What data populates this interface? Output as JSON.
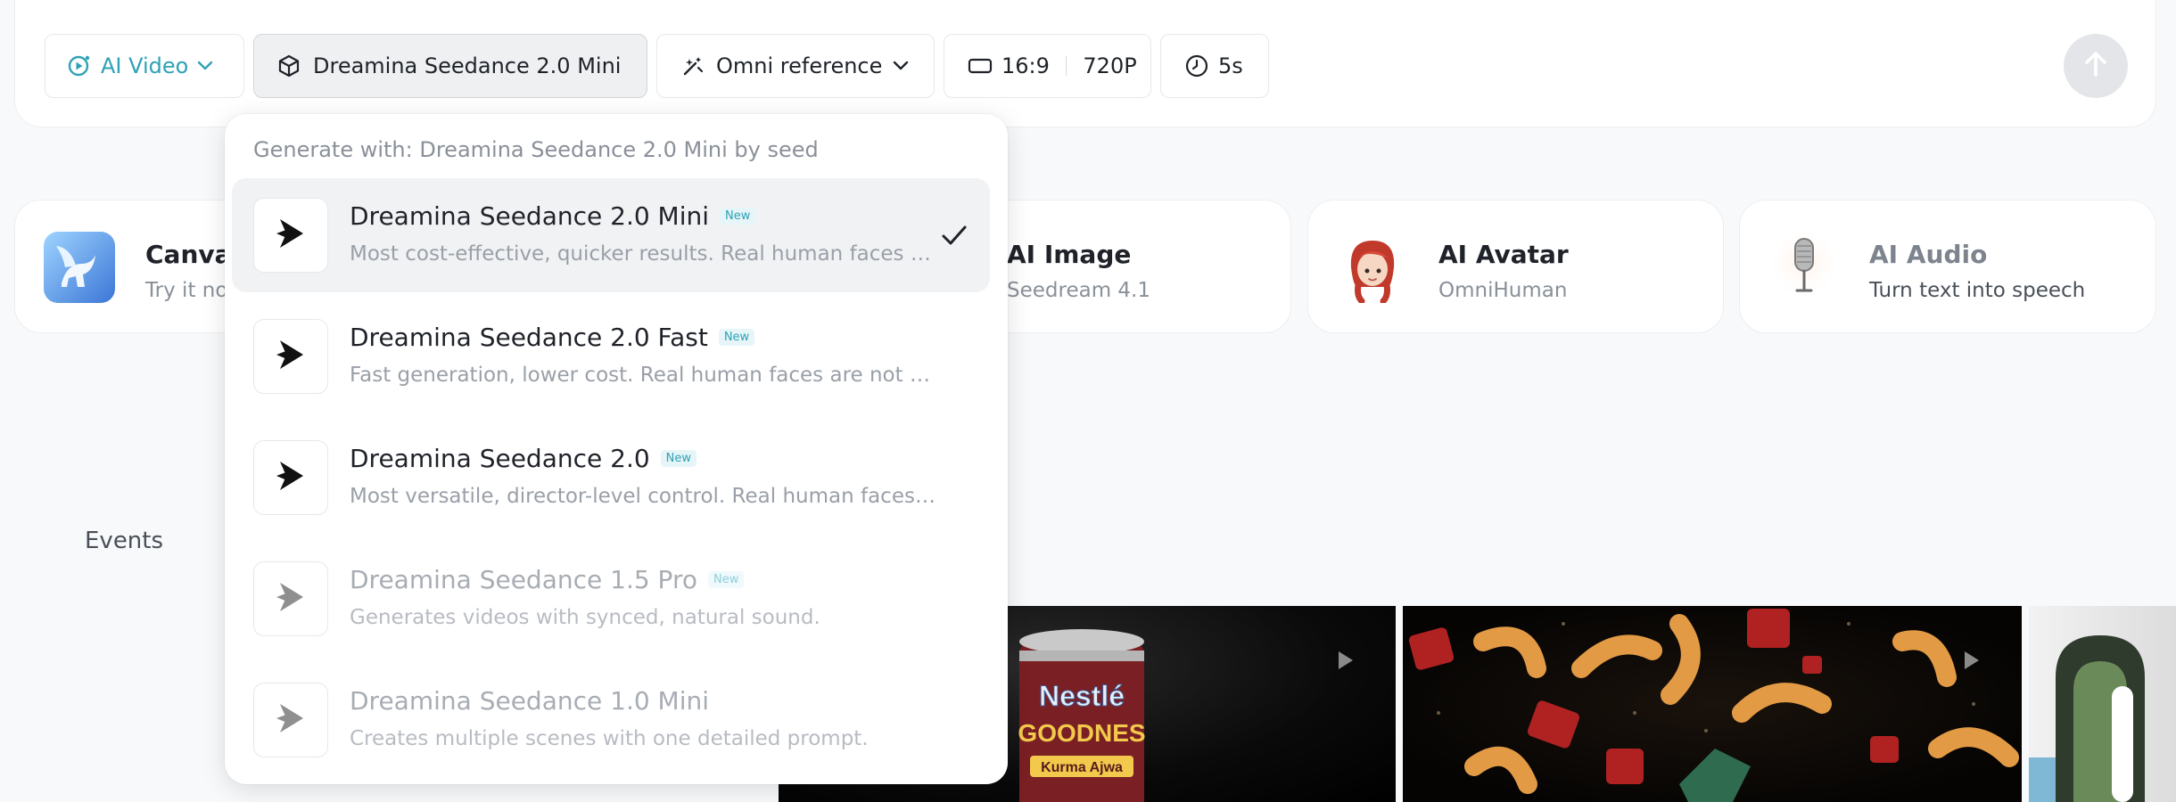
{
  "toolbar": {
    "mode_label": "AI Video",
    "model_label": "Dreamina Seedance 2.0 Mini",
    "reference_label": "Omni reference",
    "ratio_label": "16:9",
    "resolution_label": "720P",
    "duration_label": "5s"
  },
  "dropdown": {
    "header": "Generate with: Dreamina Seedance 2.0 Mini by seed",
    "options": [
      {
        "title": "Dreamina Seedance 2.0 Mini",
        "badge": "New",
        "desc": "Most cost-effective, quicker results. Real human faces are not supported.",
        "selected": true,
        "disabled": false
      },
      {
        "title": "Dreamina Seedance 2.0 Fast",
        "badge": "New",
        "desc": "Fast generation, lower cost. Real human faces are not supported.",
        "selected": false,
        "disabled": false
      },
      {
        "title": "Dreamina Seedance 2.0",
        "badge": "New",
        "desc": "Most versatile, director-level control. Real human faces are not supported.",
        "selected": false,
        "disabled": false
      },
      {
        "title": "Dreamina Seedance 1.5 Pro",
        "badge": "New",
        "desc": "Generates videos with synced, natural sound.",
        "selected": false,
        "disabled": true
      },
      {
        "title": "Dreamina Seedance 1.0 Mini",
        "badge": "",
        "desc": "Creates multiple scenes with one detailed prompt.",
        "selected": false,
        "disabled": true
      }
    ]
  },
  "features": {
    "canvas": {
      "title": "Canvas",
      "subtitle": "Try it now"
    },
    "image": {
      "title": "AI Image",
      "subtitle": "Seedream 4.1"
    },
    "avatar": {
      "title": "AI Avatar",
      "subtitle": "OmniHuman"
    },
    "audio": {
      "title": "AI Audio",
      "subtitle": "Turn text into speech"
    }
  },
  "events_label": "Events",
  "gallery": {
    "tile1_brand": "Nestlé",
    "tile1_product": "GOODNES",
    "tile1_flavor": "Kurma Ajwa"
  },
  "colors": {
    "accent": "#2ea2b5",
    "text": "#1f2329",
    "muted": "#8a9099"
  }
}
